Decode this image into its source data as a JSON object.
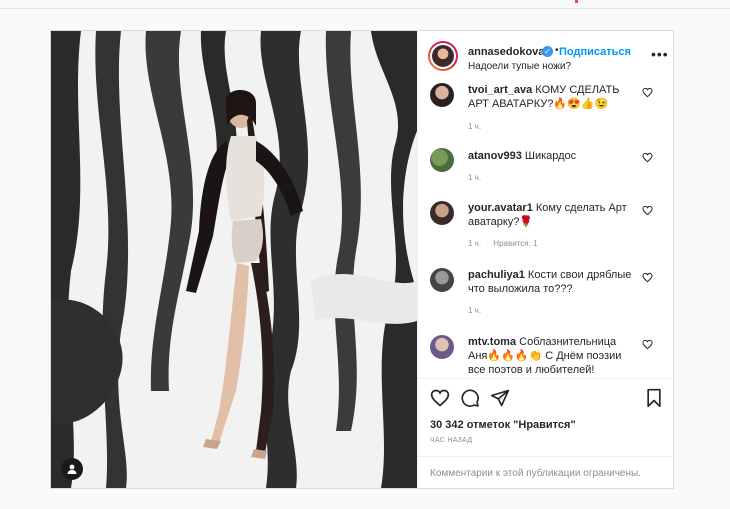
{
  "post": {
    "username": "annasedokova",
    "follow_label": "Подписаться",
    "caption": "Надоели тупые ножи?",
    "likes": "30 342 отметок \"Нравится\"",
    "time_ago": "час назад",
    "comments_closed": "Комментарии к этой публикации ограничены."
  },
  "comments": [
    {
      "user": "tvoi_art_ava",
      "text": "КОМУ СДЕЛАТЬ АРТ АВАТАРКУ?🔥😍👍😉",
      "time": "1 ч.",
      "likes": ""
    },
    {
      "user": "atanov993",
      "text": "Шикардос",
      "time": "1 ч.",
      "likes": ""
    },
    {
      "user": "your.avatar1",
      "text": "Кому сделать Арт аватарку?🌹",
      "time": "1 ч.",
      "likes": "Нравится: 1"
    },
    {
      "user": "pachuliya1",
      "text": "Кости свои дряблые что выложила то???",
      "time": "1 ч.",
      "likes": ""
    },
    {
      "user": "mtv.toma",
      "text": "Соблазнительница Аня🔥🔥🔥👏 С Днём поэзии все поэтов и любителей!",
      "time": "",
      "likes": ""
    }
  ],
  "colors": {
    "accent": "#0095f6",
    "verified": "#3897f0",
    "muted": "#8e8e8e"
  },
  "icons": [
    "heart-icon",
    "comment-icon",
    "share-icon",
    "bookmark-icon",
    "more-icon",
    "user-tag-icon",
    "verified-icon"
  ]
}
